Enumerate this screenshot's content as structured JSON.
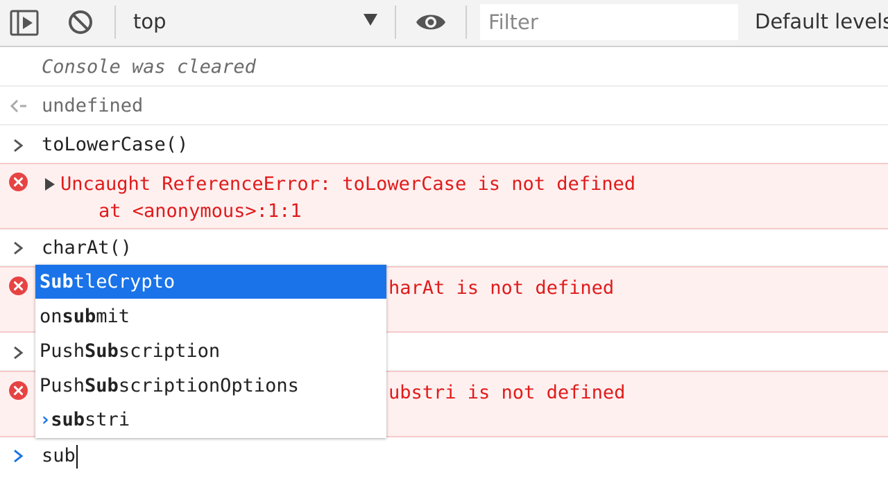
{
  "toolbar": {
    "context": "top",
    "filter_placeholder": "Filter",
    "levels_label": "Default levels",
    "icons": [
      "sidebar-toggle-icon",
      "clear-console-icon",
      "dropdown-arrow-icon",
      "eye-icon"
    ]
  },
  "console": {
    "cleared_message": "Console was cleared",
    "result_undefined": "undefined",
    "input_1": "toLowerCase()",
    "error_1_line1": "Uncaught ReferenceError: toLowerCase is not defined",
    "error_1_line2": "    at <anonymous>:1:1",
    "input_2": "charAt()",
    "error_2_visible": "harAt is not defined",
    "error_3_visible": "ubstri is not defined",
    "prompt_text": "sub"
  },
  "autocomplete": [
    {
      "pre": "",
      "match": "Sub",
      "post": "tleCrypto"
    },
    {
      "pre": "on",
      "match": "sub",
      "post": "mit"
    },
    {
      "pre": "Push",
      "match": "Sub",
      "post": "scription"
    },
    {
      "pre": "Push",
      "match": "Sub",
      "post": "scriptionOptions"
    },
    {
      "pre": "",
      "match": "sub",
      "post": "stri"
    }
  ],
  "colors": {
    "error_text": "#e01b1b",
    "error_bg": "#fff0f0",
    "selection": "#1a73e8",
    "prompt_accent": "#1a73e8"
  }
}
